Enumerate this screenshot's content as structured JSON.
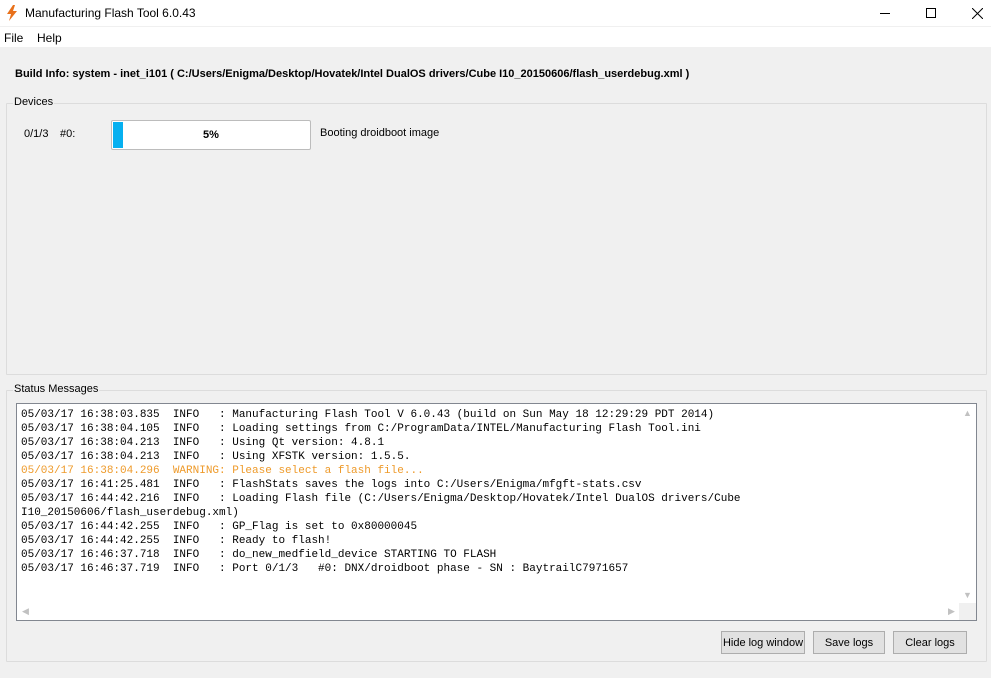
{
  "window": {
    "title": "Manufacturing Flash Tool 6.0.43",
    "icon": "lightning-icon"
  },
  "menu": {
    "file": "File",
    "help": "Help"
  },
  "build_info": "Build Info:  system - inet_i101 ( C:/Users/Enigma/Desktop/Hovatek/Intel DualOS drivers/Cube I10_20150606/flash_userdebug.xml )",
  "devices": {
    "label": "Devices",
    "items": [
      {
        "port": "0/1/3",
        "num": "#0:",
        "progress_text": "5%",
        "progress_fraction": 0.05,
        "status": "Booting droidboot image"
      }
    ]
  },
  "status": {
    "label": "Status Messages",
    "lines": [
      {
        "text": "05/03/17 16:38:03.835  INFO   : Manufacturing Flash Tool V 6.0.43 (build on Sun May 18 12:29:29 PDT 2014)",
        "level": "info"
      },
      {
        "text": "05/03/17 16:38:04.105  INFO   : Loading settings from C:/ProgramData/INTEL/Manufacturing Flash Tool.ini",
        "level": "info"
      },
      {
        "text": "05/03/17 16:38:04.213  INFO   : Using Qt version: 4.8.1",
        "level": "info"
      },
      {
        "text": "05/03/17 16:38:04.213  INFO   : Using XFSTK version: 1.5.5.",
        "level": "info"
      },
      {
        "text": "05/03/17 16:38:04.296  WARNING: Please select a flash file...",
        "level": "warning"
      },
      {
        "text": "05/03/17 16:41:25.481  INFO   : FlashStats saves the logs into C:/Users/Enigma/mfgft-stats.csv",
        "level": "info"
      },
      {
        "text": "05/03/17 16:44:42.216  INFO   : Loading Flash file (C:/Users/Enigma/Desktop/Hovatek/Intel DualOS drivers/Cube",
        "level": "info"
      },
      {
        "text": "I10_20150606/flash_userdebug.xml)",
        "level": "info"
      },
      {
        "text": "05/03/17 16:44:42.255  INFO   : GP_Flag is set to 0x80000045",
        "level": "info"
      },
      {
        "text": "05/03/17 16:44:42.255  INFO   : Ready to flash!",
        "level": "info"
      },
      {
        "text": "05/03/17 16:46:37.718  INFO   : do_new_medfield_device STARTING TO FLASH",
        "level": "info"
      },
      {
        "text": "05/03/17 16:46:37.719  INFO   : Port 0/1/3   #0: DNX/droidboot phase - SN : BaytrailC7971657",
        "level": "info"
      }
    ],
    "warning_color": "#ee9a2a"
  },
  "buttons": {
    "hide_log": "Hide log window",
    "save_logs": "Save logs",
    "clear_logs": "Clear logs"
  },
  "colors": {
    "progress_fill": "#06b0f0",
    "background": "#f0f0f0"
  }
}
